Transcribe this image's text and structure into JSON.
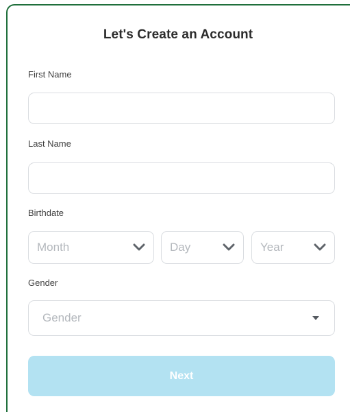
{
  "form": {
    "title": "Let's Create an Account",
    "first_name": {
      "label": "First Name",
      "value": "",
      "placeholder": ""
    },
    "last_name": {
      "label": "Last Name",
      "value": "",
      "placeholder": ""
    },
    "birthdate": {
      "label": "Birthdate",
      "month_placeholder": "Month",
      "day_placeholder": "Day",
      "year_placeholder": "Year",
      "chevron_icon": "chevron-down-icon"
    },
    "gender": {
      "label": "Gender",
      "placeholder": "Gender",
      "caret_icon": "caret-down-icon"
    },
    "next_label": "Next"
  },
  "colors": {
    "accent_border": "#1f6f3b",
    "next_button_bg": "#b3e2f2",
    "next_button_text": "#ffffff",
    "field_border": "#dadde1",
    "placeholder_text": "#b4b8bd"
  }
}
